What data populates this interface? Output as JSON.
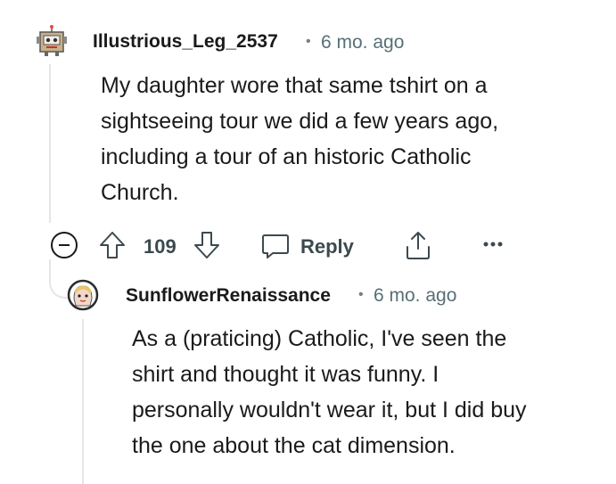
{
  "comment": {
    "username": "Illustrious_Leg_2537",
    "separator": "•",
    "time": "6 mo. ago",
    "body_lines": [
      "My daughter wore that same tshirt on a",
      "sightseeing tour we did a few years ago,",
      "including a tour of an historic Catholic",
      "Church."
    ],
    "avatar_icon": "robot-avatar-icon",
    "actions": {
      "collapse_icon": "collapse-minus-icon",
      "upvote_icon": "upvote-arrow-icon",
      "vote_count": "109",
      "downvote_icon": "downvote-arrow-icon",
      "reply_icon": "speech-bubble-icon",
      "reply_label": "Reply",
      "share_icon": "share-icon",
      "more_icon": "more-dots-icon"
    }
  },
  "reply": {
    "username": "SunflowerRenaissance",
    "separator": "•",
    "time": "6 mo. ago",
    "body_lines": [
      "As a (praticing) Catholic, I've seen the",
      "shirt and thought it was funny. I",
      "personally wouldn't wear it, but I did buy",
      "the one about the cat dimension."
    ],
    "avatar_icon": "anime-avatar-icon"
  },
  "colors": {
    "text": "#1a1a1b",
    "meta": "#576f76",
    "icon": "#3c4a4f",
    "thread_line": "#e6e6e6"
  }
}
